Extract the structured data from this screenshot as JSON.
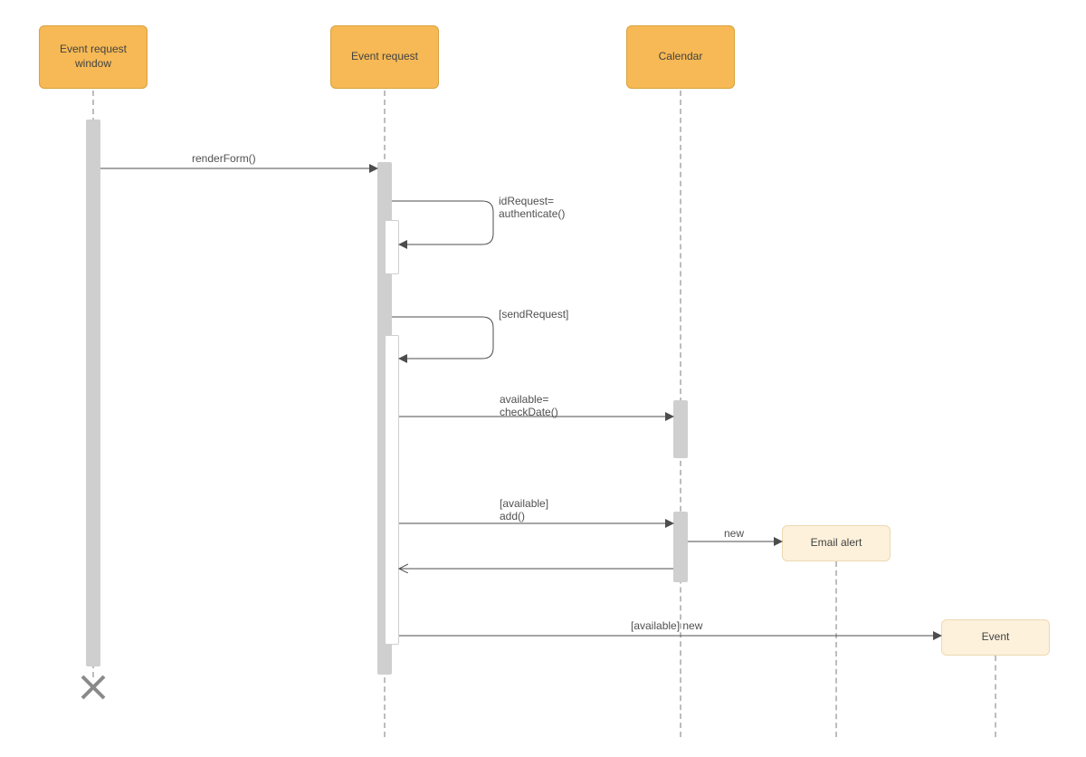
{
  "lifelines": {
    "a": {
      "label": "Event request\nwindow"
    },
    "b": {
      "label": "Event request"
    },
    "c": {
      "label": "Calendar"
    },
    "d": {
      "label": "Email alert"
    },
    "e": {
      "label": "Event"
    }
  },
  "messages": {
    "renderForm": "renderForm()",
    "authenticate": "idRequest=\nauthenticate()",
    "sendRequest": "[sendRequest]",
    "checkDate": "available=\ncheckDate()",
    "add": "[available]\nadd()",
    "new_email": "new",
    "new_event": "[available] new"
  }
}
